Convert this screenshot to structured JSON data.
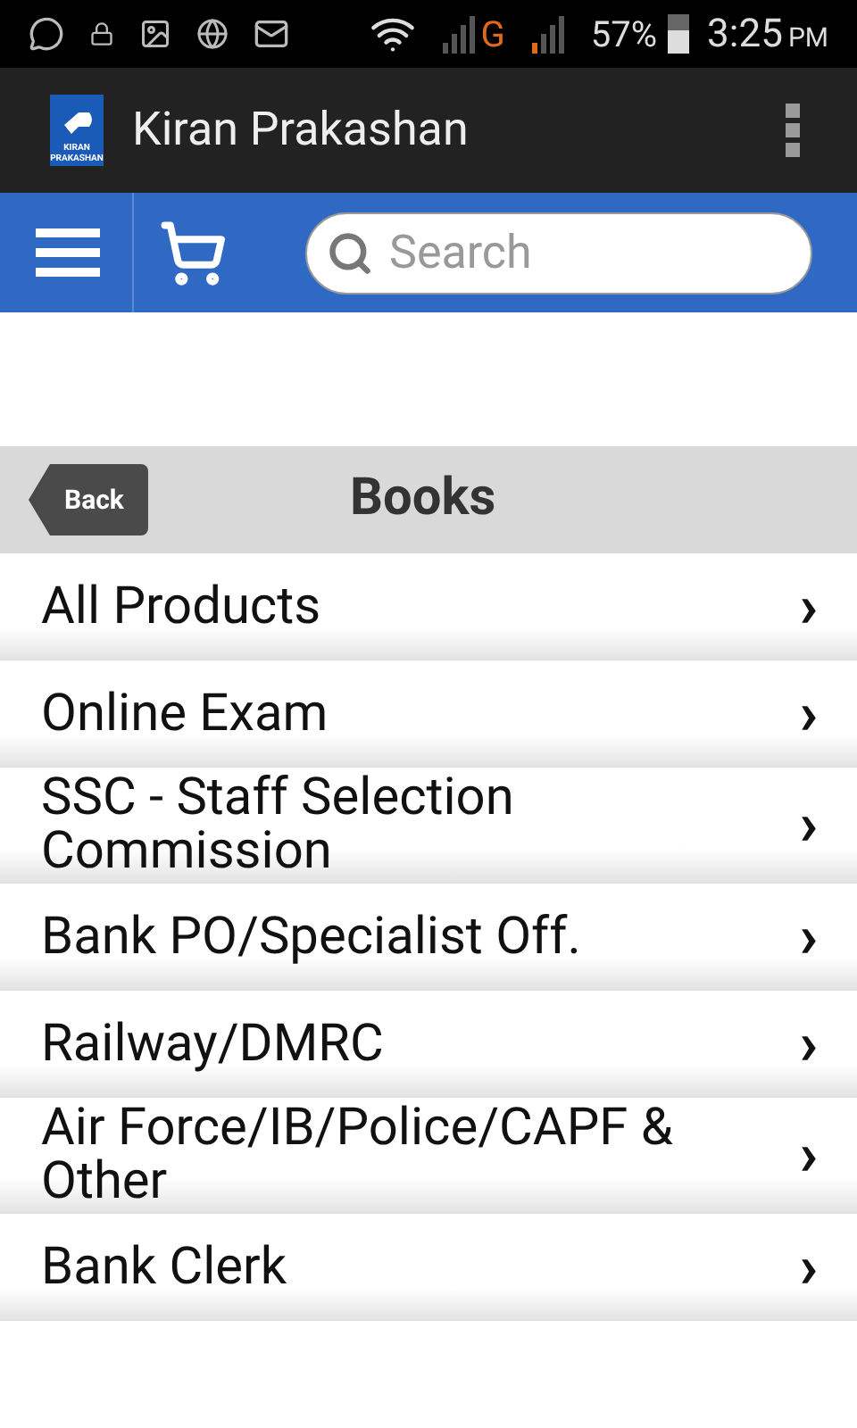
{
  "status_bar": {
    "network": "G",
    "battery": "57%",
    "time": "3:25",
    "ampm": "PM"
  },
  "app_bar": {
    "logo_text": [
      "KIRAN",
      "PRAKASHAN"
    ],
    "title": "Kiran Prakashan"
  },
  "toolbar": {
    "search": {
      "placeholder": "Search"
    }
  },
  "section": {
    "back": "Back",
    "title": "Books"
  },
  "items": [
    {
      "label": "All Products",
      "chevron": "›"
    },
    {
      "label": "Online Exam",
      "chevron": "›"
    },
    {
      "label": "SSC - Staff Selection Commission",
      "chevron": "›"
    },
    {
      "label": "Bank PO/Specialist Off.",
      "chevron": "›"
    },
    {
      "label": "Railway/DMRC",
      "chevron": "›"
    },
    {
      "label": "Air Force/IB/Police/CAPF & Other",
      "chevron": "›"
    },
    {
      "label": "Bank Clerk",
      "chevron": "›"
    }
  ]
}
